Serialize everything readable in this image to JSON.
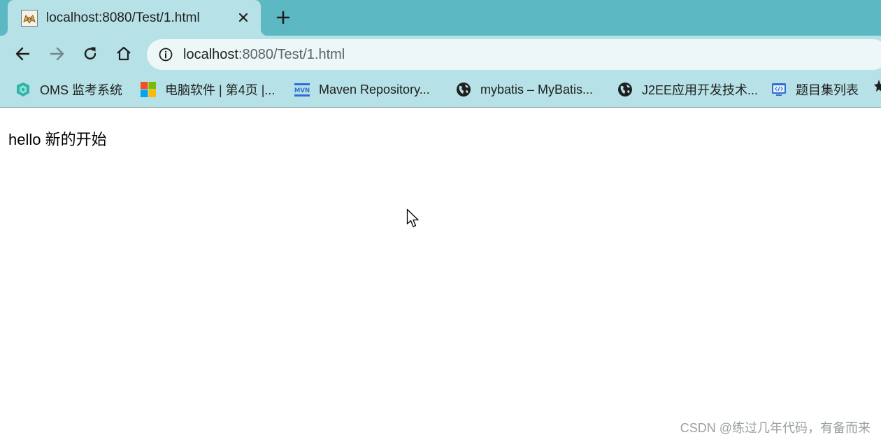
{
  "tab": {
    "title": "localhost:8080/Test/1.html",
    "favicon": "tomcat-icon"
  },
  "toolbar": {
    "url_host": "localhost",
    "url_path": ":8080/Test/1.html"
  },
  "bookmarks": [
    {
      "label": "OMS 监考系统",
      "icon": "shield-icon"
    },
    {
      "label": "电脑软件 | 第4页 |...",
      "icon": "windows-logo-icon"
    },
    {
      "label": "Maven Repository...",
      "icon": "mvn-logo-icon"
    },
    {
      "label": "mybatis – MyBatis...",
      "icon": "globe-icon"
    },
    {
      "label": "J2EE应用开发技术...",
      "icon": "globe-icon"
    },
    {
      "label": "题目集列表",
      "icon": "code-window-icon"
    }
  ],
  "page": {
    "text": "hello 新的开始"
  },
  "watermark": "CSDN @练过几年代码，有备而来",
  "colors": {
    "tabstrip": "#5cb8c2",
    "toolbar": "#b6e1e6",
    "omnibox": "#edf7f8"
  }
}
